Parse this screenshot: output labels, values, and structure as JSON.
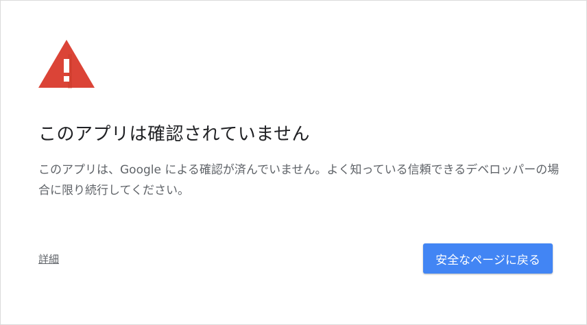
{
  "error_page": {
    "icon": "warning-triangle-icon",
    "icon_color": "#db4437",
    "title": "このアプリは確認されていません",
    "description": "このアプリは、Google による確認が済んでいません。よく知っている信頼できるデベロッパーの場合に限り続行してください。",
    "details_link": "詳細",
    "back_button": "安全なページに戻る",
    "button_color": "#4285f4"
  }
}
